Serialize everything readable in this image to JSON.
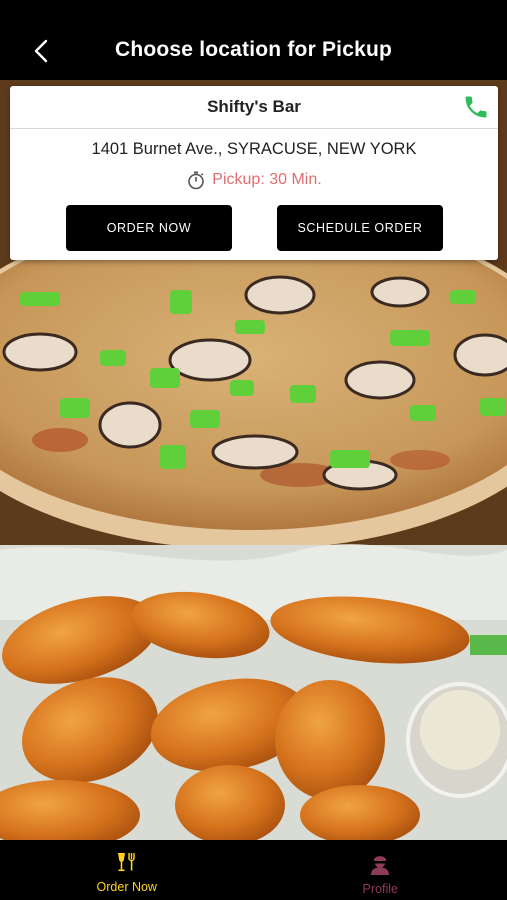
{
  "header": {
    "title": "Choose location for Pickup",
    "back_icon": "chevron-left-icon"
  },
  "location": {
    "name": "Shifty's Bar",
    "address": "1401 Burnet Ave., SYRACUSE, NEW YORK",
    "pickup_time": "Pickup: 30 Min.",
    "phone_icon": "phone-icon",
    "timer_icon": "stopwatch-icon"
  },
  "actions": {
    "order_now": "ORDER NOW",
    "schedule_order": "SCHEDULE ORDER"
  },
  "tabbar": {
    "items": [
      {
        "label": "Order Now",
        "icon": "dining-icon",
        "color": "#ffd21c",
        "active": true
      },
      {
        "label": "Profile",
        "icon": "user-icon",
        "color": "#8e3b5a",
        "active": false
      }
    ]
  },
  "colors": {
    "header_bg": "#000000",
    "accent_yellow": "#ffd21c",
    "pickup_red": "#e06d6d",
    "phone_green": "#2ebd59",
    "profile_plum": "#8e3b5a"
  }
}
